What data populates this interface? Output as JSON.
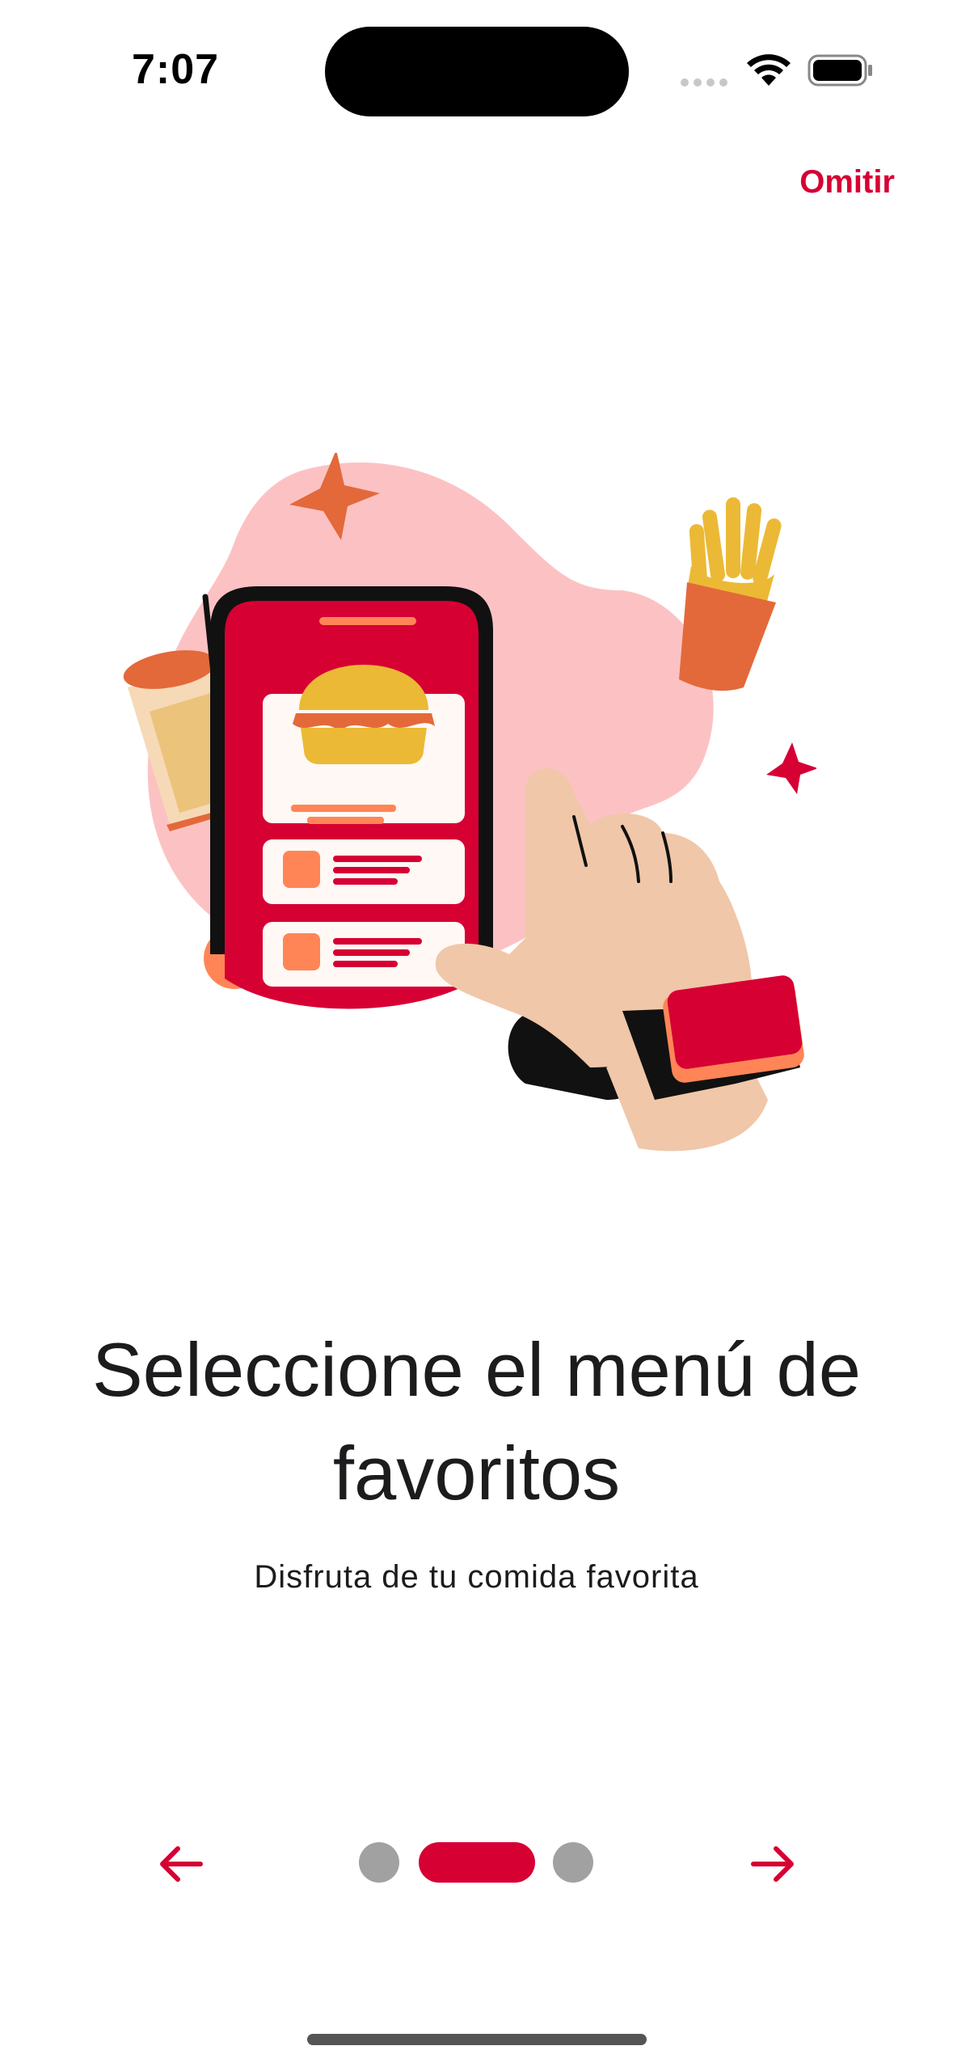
{
  "status_bar": {
    "time": "7:07"
  },
  "header": {
    "skip_label": "Omitir"
  },
  "onboarding": {
    "title": "Seleccione el menú de favoritos",
    "subtitle": "Disfruta de tu comida favorita",
    "current_page": 2,
    "total_pages": 3
  },
  "illustration": {
    "icons": [
      "drink-cup-icon",
      "french-fries-icon",
      "smartphone-icon",
      "burger-icon",
      "pointing-hand-icon",
      "smartwatch-icon",
      "star-icon"
    ]
  },
  "colors": {
    "accent": "#d60033",
    "inactive_dot": "#a1a1a1",
    "blob": "#fcc2c3",
    "orange": "#e3693a",
    "yellow": "#ebb935",
    "skin": "#f0c7a8"
  },
  "navigation": {
    "prev_icon": "arrow-left-icon",
    "next_icon": "arrow-right-icon"
  }
}
